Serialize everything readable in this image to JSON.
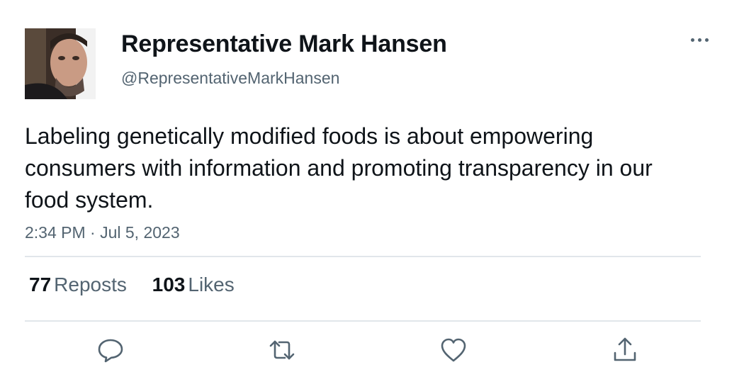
{
  "author": {
    "display_name": "Representative Mark Hansen",
    "handle": "@RepresentativeMarkHansen",
    "avatar_icon": "profile-photo"
  },
  "menu_icon": "more-horizontal-icon",
  "tweet": {
    "text": "Labeling genetically modified foods is about empowering consumers with information and promoting transparency in our food system.",
    "timestamp": "2:34 PM · Jul 5, 2023"
  },
  "stats": {
    "reposts_count": "77",
    "reposts_label": "Reposts",
    "likes_count": "103",
    "likes_label": "Likes"
  },
  "actions": [
    {
      "icon": "reply-icon"
    },
    {
      "icon": "repost-icon"
    },
    {
      "icon": "like-icon"
    },
    {
      "icon": "share-icon"
    }
  ],
  "colors": {
    "text_primary": "#0f1419",
    "text_secondary": "#536471",
    "divider": "#e1e6ea"
  }
}
